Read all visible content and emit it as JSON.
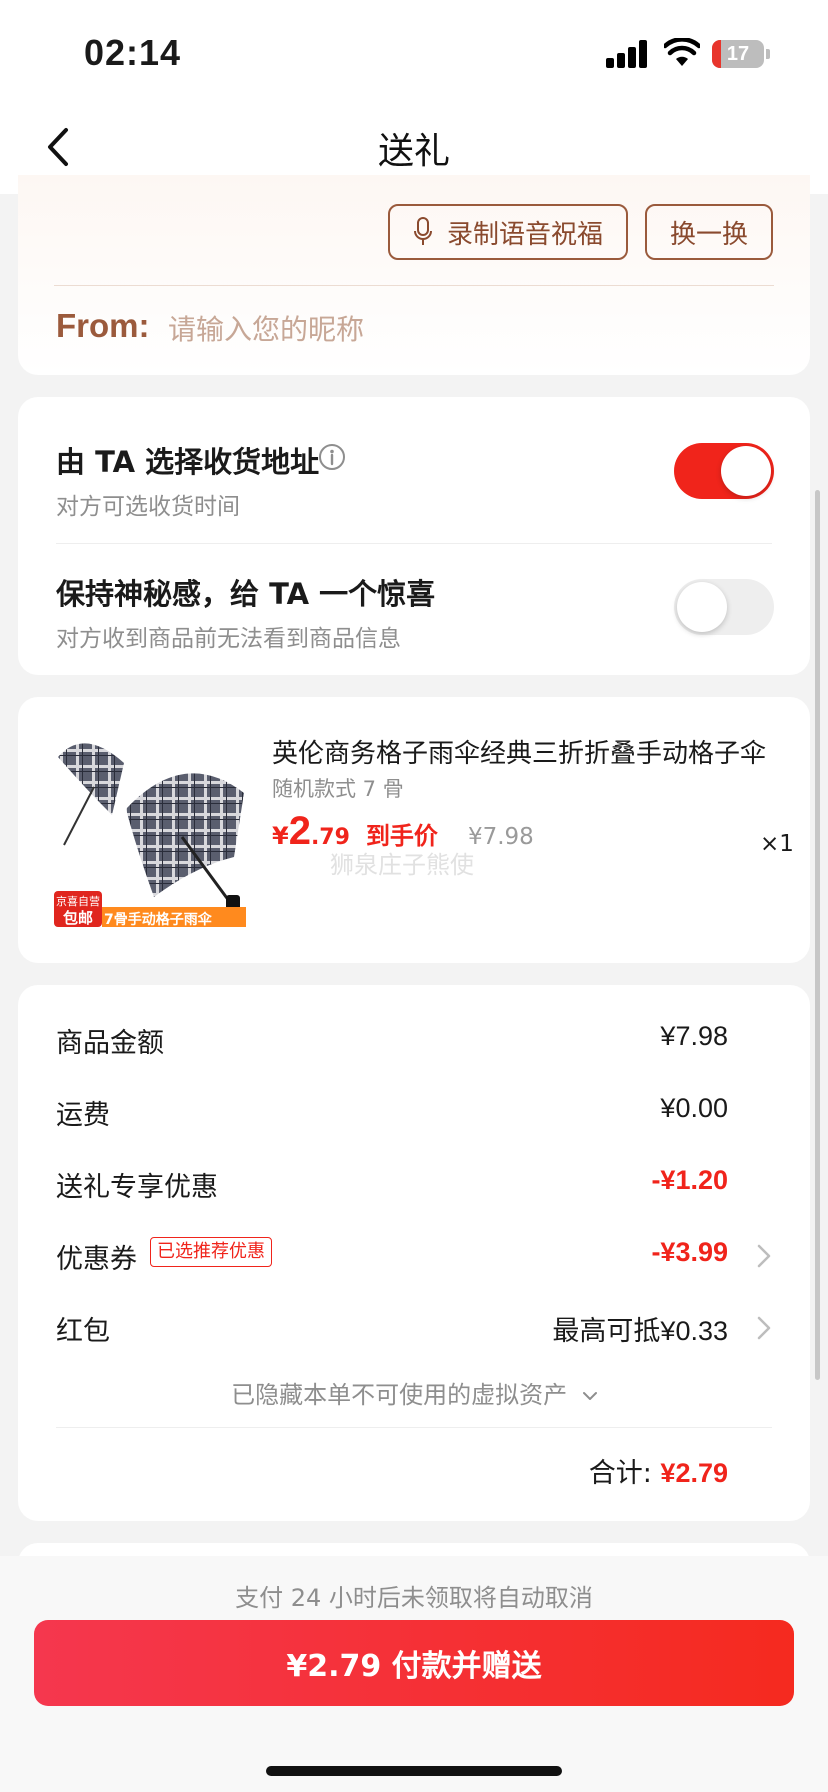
{
  "status_bar": {
    "time": "02:14",
    "battery": "17",
    "battery_fraction": 0.17
  },
  "nav": {
    "title": "送礼"
  },
  "message": {
    "voice_button": "录制语音祝福",
    "swap_button": "换一换",
    "from_label": "From:",
    "from_placeholder": "请输入您的昵称"
  },
  "options": [
    {
      "title": "由 TA 选择收货地址",
      "subtitle": "对方可选收货时间",
      "enabled": true
    },
    {
      "title": "保持神秘感，给 TA 一个惊喜",
      "subtitle": "对方收到商品前无法看到商品信息",
      "enabled": false
    }
  ],
  "product": {
    "title": "英伦商务格子雨伞经典三折折叠手动格子伞",
    "spec": "随机款式 7 骨",
    "price_symbol": "¥",
    "price_int": "2",
    "price_dec": ".79",
    "price_tag": "到手价",
    "original_price": "¥7.98",
    "quantity": "×1",
    "watermark": "狮泉庄子熊使",
    "image_badge_top": "京喜自营",
    "image_badge_main": "包邮",
    "image_caption": "7骨手动格子雨伞"
  },
  "fees": {
    "rows": [
      {
        "label": "商品金额",
        "value": "¥7.98"
      },
      {
        "label": "运费",
        "value": "¥0.00"
      },
      {
        "label": "送礼专享优惠",
        "value": "-¥1.20"
      },
      {
        "label": "优惠券",
        "badge": "已选推荐优惠",
        "value": "-¥3.99"
      },
      {
        "label": "红包",
        "value": "最高可抵¥0.33"
      }
    ],
    "hidden_assets": "已隐藏本单不可使用的虚拟资产",
    "total_label": "合计:",
    "total_value": "¥2.79"
  },
  "bottom": {
    "notice": "支付 24 小时后未领取将自动取消",
    "pay_button": "¥2.79 付款并赠送"
  },
  "colors": {
    "accent": "#f0241b",
    "brown": "#9b5a3c"
  }
}
